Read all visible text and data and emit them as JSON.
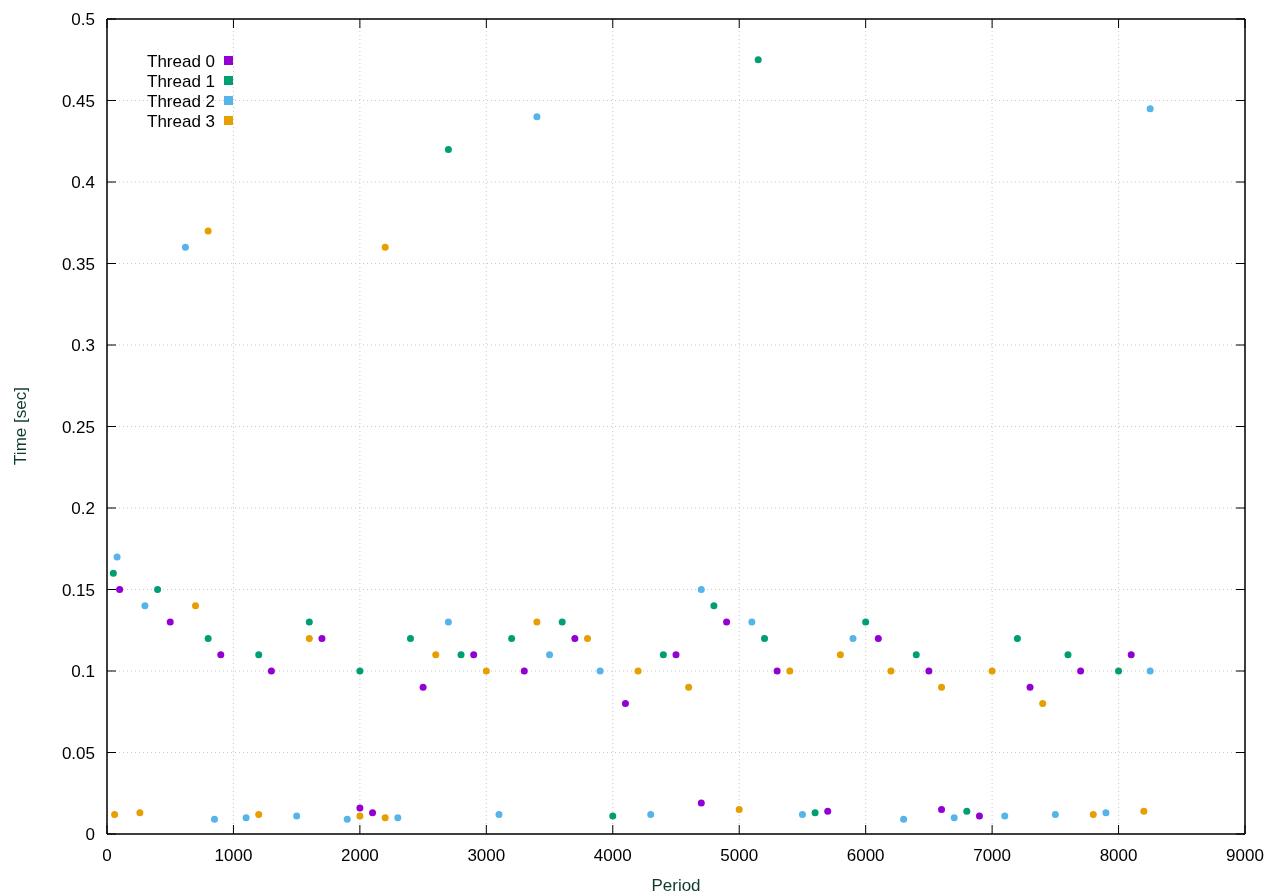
{
  "chart_data": {
    "type": "scatter",
    "grid": true,
    "legend": "top-left",
    "xlabel": "Period",
    "ylabel": "Time [sec]",
    "xlim": [
      0,
      9000
    ],
    "ylim": [
      0,
      0.5
    ],
    "xticks": [
      {
        "value": 0,
        "label": "0"
      },
      {
        "value": 1000,
        "label": "1000"
      },
      {
        "value": 2000,
        "label": "2000"
      },
      {
        "value": 3000,
        "label": "3000"
      },
      {
        "value": 4000,
        "label": "4000"
      },
      {
        "value": 5000,
        "label": "5000"
      },
      {
        "value": 6000,
        "label": "6000"
      },
      {
        "value": 7000,
        "label": "7000"
      },
      {
        "value": 8000,
        "label": "8000"
      },
      {
        "value": 9000,
        "label": "9000"
      }
    ],
    "yticks": [
      {
        "value": 0,
        "label": "0"
      },
      {
        "value": 0.05,
        "label": "0.05"
      },
      {
        "value": 0.1,
        "label": "0.1"
      },
      {
        "value": 0.15,
        "label": "0.15"
      },
      {
        "value": 0.2,
        "label": "0.2"
      },
      {
        "value": 0.25,
        "label": "0.25"
      },
      {
        "value": 0.3,
        "label": "0.3"
      },
      {
        "value": 0.35,
        "label": "0.35"
      },
      {
        "value": 0.4,
        "label": "0.4"
      },
      {
        "value": 0.45,
        "label": "0.45"
      },
      {
        "value": 0.5,
        "label": "0.5"
      }
    ],
    "series": [
      {
        "name": "Thread 0",
        "color": "#9400d3",
        "x": [
          100,
          500,
          900,
          1300,
          1700,
          2100,
          2500,
          2900,
          3300,
          3700,
          4100,
          4500,
          4900,
          5300,
          5700,
          6100,
          6500,
          6900,
          7300,
          7700,
          8100,
          2000,
          4700,
          6600
        ],
        "values": [
          0.15,
          0.13,
          0.11,
          0.1,
          0.12,
          0.013,
          0.09,
          0.11,
          0.1,
          0.12,
          0.08,
          0.11,
          0.13,
          0.1,
          0.014,
          0.12,
          0.1,
          0.011,
          0.09,
          0.1,
          0.11,
          0.016,
          0.019,
          0.015
        ]
      },
      {
        "name": "Thread 1",
        "color": "#009e73",
        "x": [
          50,
          400,
          800,
          1200,
          1600,
          2000,
          2400,
          2800,
          3200,
          3600,
          4000,
          4400,
          4800,
          5200,
          5600,
          6000,
          6400,
          6800,
          7200,
          7600,
          8000,
          2700,
          5150
        ],
        "values": [
          0.16,
          0.15,
          0.12,
          0.11,
          0.13,
          0.1,
          0.12,
          0.11,
          0.12,
          0.13,
          0.011,
          0.11,
          0.14,
          0.12,
          0.013,
          0.13,
          0.11,
          0.014,
          0.12,
          0.11,
          0.1,
          0.42,
          0.475
        ]
      },
      {
        "name": "Thread 2",
        "color": "#56b4e9",
        "x": [
          80,
          300,
          850,
          1100,
          1500,
          1900,
          2300,
          2700,
          3100,
          3500,
          3900,
          4300,
          4700,
          5100,
          5500,
          5900,
          6300,
          6700,
          7100,
          7500,
          7900,
          8250,
          3400,
          8250,
          620
        ],
        "values": [
          0.17,
          0.14,
          0.009,
          0.01,
          0.011,
          0.009,
          0.01,
          0.13,
          0.012,
          0.11,
          0.1,
          0.012,
          0.15,
          0.13,
          0.012,
          0.12,
          0.009,
          0.01,
          0.011,
          0.012,
          0.013,
          0.1,
          0.44,
          0.445,
          0.36
        ]
      },
      {
        "name": "Thread 3",
        "color": "#e69f00",
        "x": [
          60,
          260,
          700,
          1200,
          1600,
          2000,
          2200,
          2600,
          3000,
          3400,
          3800,
          4200,
          4600,
          5000,
          5400,
          5800,
          6200,
          6600,
          7000,
          7400,
          7800,
          8200,
          800,
          2200
        ],
        "values": [
          0.012,
          0.013,
          0.14,
          0.012,
          0.12,
          0.011,
          0.01,
          0.11,
          0.1,
          0.13,
          0.12,
          0.1,
          0.09,
          0.015,
          0.1,
          0.11,
          0.1,
          0.09,
          0.1,
          0.08,
          0.012,
          0.014,
          0.37,
          0.36
        ]
      }
    ]
  }
}
